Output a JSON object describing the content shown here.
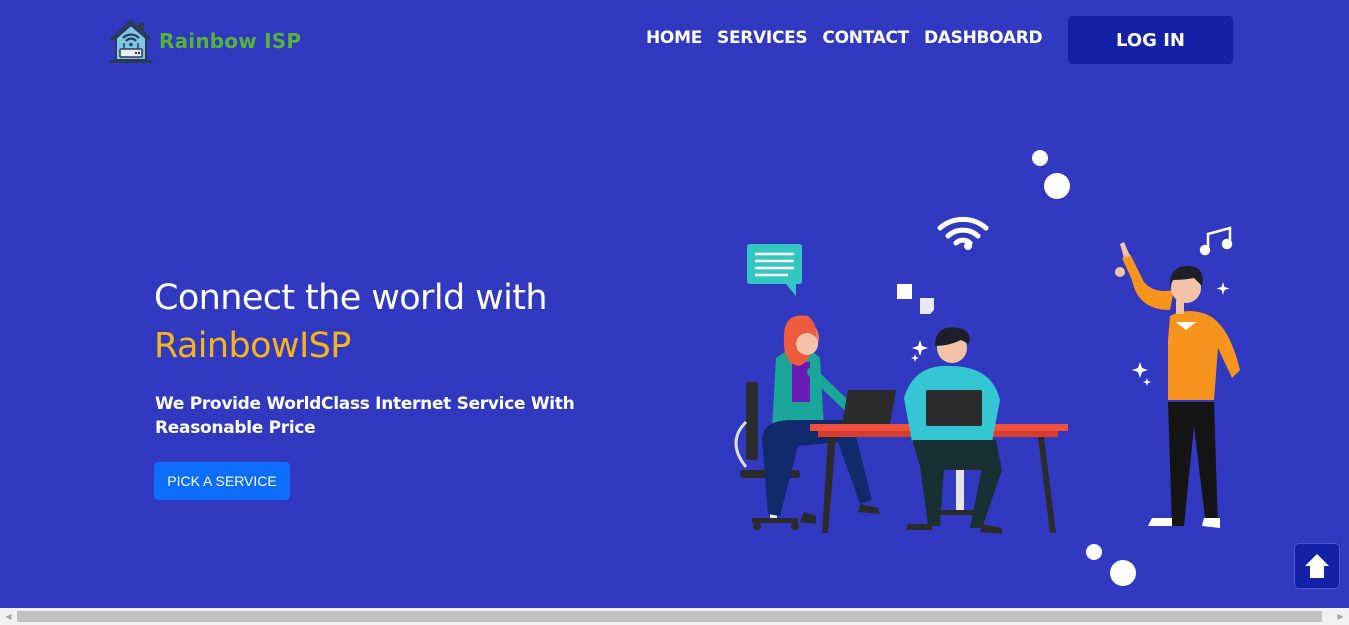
{
  "header": {
    "logo_text": "Rainbow ISP",
    "logo_icon": "house-wifi-router-icon",
    "nav": [
      {
        "label": "HOME"
      },
      {
        "label": "SERVICES"
      },
      {
        "label": "CONTACT"
      },
      {
        "label": "DASHBOARD"
      }
    ],
    "login_label": "LOG IN"
  },
  "hero": {
    "title_line1": "Connect the world with",
    "title_brand": "RainbowISP",
    "subtitle": "We Provide WorldClass Internet Service With Reasonable Price",
    "cta_label": "PICK A SERVICE",
    "illustration": "team-working-at-desk-illustration"
  },
  "scroll_top_icon": "arrow-up-icon",
  "colors": {
    "page_bg": "#3039c0",
    "brand_green": "#55b33a",
    "accent_yellow": "#f6b31b",
    "login_bg": "#1321a6",
    "cta_bg": "#0d6efd"
  }
}
